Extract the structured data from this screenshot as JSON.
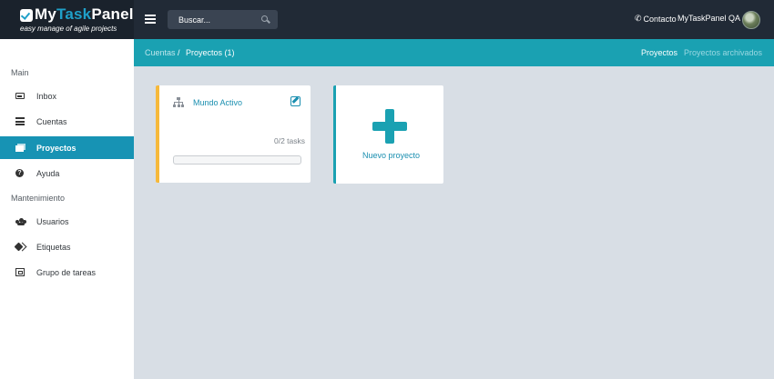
{
  "header": {
    "logo_prefix": "My",
    "logo_accent": "Task",
    "logo_suffix": "Panel",
    "tagline": "easy manage of agile projects",
    "search_placeholder": "Buscar...",
    "contact_label": "Contacto",
    "user_name": "MyTaskPanel QA"
  },
  "sidebar": {
    "section_main": "Main",
    "section_maintenance": "Mantenimiento",
    "items": [
      {
        "label": "Inbox",
        "icon": "inbox-icon"
      },
      {
        "label": "Cuentas",
        "icon": "list-icon"
      },
      {
        "label": "Proyectos",
        "icon": "projects-icon",
        "active": true
      },
      {
        "label": "Ayuda",
        "icon": "help-icon"
      },
      {
        "label": "Usuarios",
        "icon": "users-icon"
      },
      {
        "label": "Etiquetas",
        "icon": "tags-icon"
      },
      {
        "label": "Grupo de tareas",
        "icon": "task-group-icon"
      }
    ]
  },
  "breadcrumb": {
    "parent": "Cuentas",
    "separator": "/",
    "current": "Proyectos (1)"
  },
  "tabs": {
    "projects": "Proyectos",
    "archived": "Proyectos archivados"
  },
  "project_card": {
    "title": "Mundo Activo",
    "tasks": "0/2 tasks",
    "progress": 0,
    "accent_color": "#f6b93b"
  },
  "new_project": {
    "label": "Nuevo proyecto",
    "color": "#1aa1b2"
  }
}
